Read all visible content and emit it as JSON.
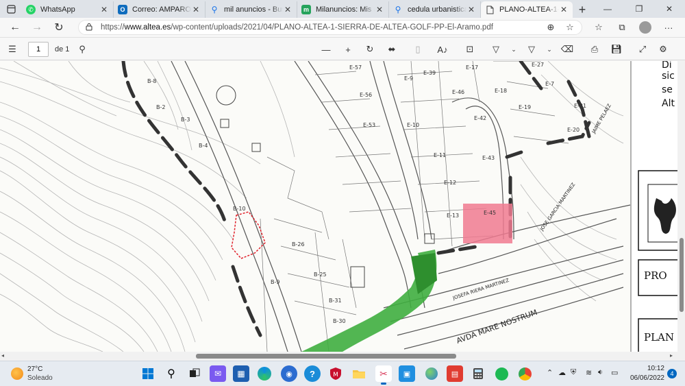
{
  "tabs": [
    {
      "title": "WhatsApp",
      "icon": "whatsapp-icon",
      "color": "#25d366"
    },
    {
      "title": "Correo: AMPARO Z...",
      "icon": "outlook-icon",
      "color": "#0f6cbd"
    },
    {
      "title": "mil anuncios - Busc...",
      "icon": "search-icon",
      "color": "#1a73e8"
    },
    {
      "title": "Milanuncios: Mis an...",
      "icon": "milanuncios-icon",
      "color": "#26a35c"
    },
    {
      "title": "cedula urbanistica p...",
      "icon": "search-icon",
      "color": "#1a73e8"
    },
    {
      "title": "PLANO-ALTEA-1-SIE...",
      "icon": "pdf-icon",
      "color": "#555555",
      "active": true
    }
  ],
  "address": {
    "prefix": "https://",
    "domain": "www.altea.es",
    "path": "/wp-content/uploads/2021/04/PLANO-ALTEA-1-SIERRA-DE-ALTEA-GOLF-PP-El-Aramo.pdf"
  },
  "pdf_toolbar": {
    "page_number": "1",
    "page_of": "de 1"
  },
  "map": {
    "parcel_labels": [
      "B-8",
      "B-2",
      "B-3",
      "B-4",
      "B-10",
      "B-9",
      "B-26",
      "B-25",
      "B-31",
      "B-30",
      "E-57",
      "E-9",
      "E-39",
      "E-17",
      "E-27",
      "E-56",
      "E-46",
      "E-18",
      "E-7",
      "E-53",
      "E-10",
      "E-19",
      "E-21",
      "E-20",
      "E-11",
      "E-43",
      "E-12",
      "E-13",
      "E-45",
      "E-42"
    ],
    "street_labels": [
      "AVDA MARE NOSTRUM",
      "JOSEFA RIERA MARTINEZ",
      "JOSE GARCIA MARTINEZ",
      "JAIME PELAEZ"
    ],
    "side_text": [
      "Di",
      "sic",
      "se",
      "Alt"
    ],
    "box_labels": [
      "PRO",
      "PLAN"
    ],
    "highlight_color": "#f07a90",
    "green_zone_color": "#3fae3f",
    "parcel_outline_color": "#e0202a"
  },
  "taskbar": {
    "weather_temp": "27°C",
    "weather_desc": "Soleado",
    "time": "10:12",
    "date": "06/06/2022",
    "notifications": "4"
  }
}
